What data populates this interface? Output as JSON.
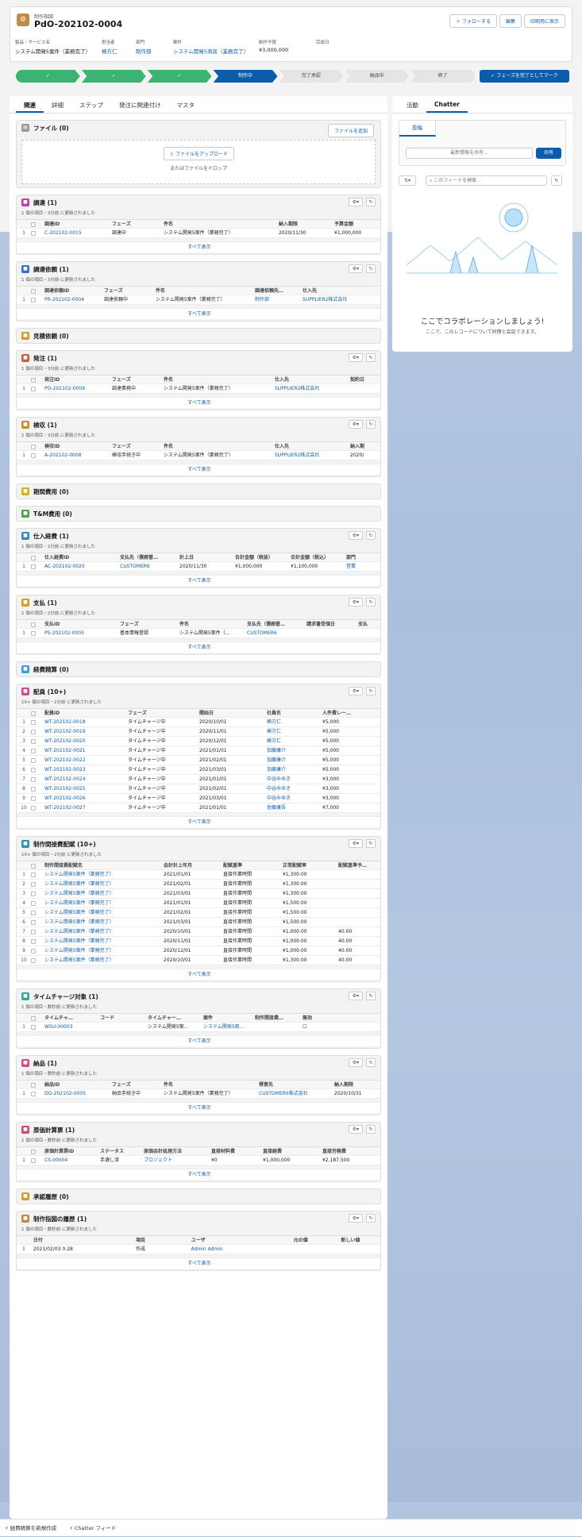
{
  "header": {
    "object_label": "制作指図",
    "title": "PdO-202102-0004",
    "buttons": [
      "フォローする",
      "編集",
      "印刷用に表示"
    ],
    "fields": [
      {
        "label": "製品・サービス名",
        "value": "システム開発5案件（業務完了）",
        "link": false
      },
      {
        "label": "担当者",
        "value": "検方仁",
        "link": true
      },
      {
        "label": "部門",
        "value": "制作部",
        "link": true
      },
      {
        "label": "案件",
        "value": "システム開発5商談（業務完了）",
        "link": true
      },
      {
        "label": "制作予算",
        "value": "¥3,000,000",
        "link": false
      },
      {
        "label": "完成日",
        "value": "",
        "link": false
      }
    ]
  },
  "path": {
    "steps": [
      "✓",
      "✓",
      "✓",
      "制作中",
      "完了承認",
      "納品中",
      "終了"
    ],
    "current_index": 3,
    "mark_button": "✓ フェーズを完了としてマーク"
  },
  "tabs": [
    "関連",
    "詳細",
    "ステップ",
    "発注に関連付け",
    "マスタ"
  ],
  "files": {
    "title": "ファイル (0)",
    "add_button": "ファイルを追加",
    "upload_button": "ファイルをアップロード",
    "drop_text": "またはファイルをドロップ"
  },
  "cards": [
    {
      "title": "調達 (1)",
      "color": "#c23ea6",
      "sub": "1 個の項目・3分前 に更新されました",
      "cols": [
        "調達ID",
        "フェーズ",
        "件名",
        "納入期限",
        "予算金額"
      ],
      "widths": [
        85,
        65,
        145,
        70,
        60
      ],
      "rows": [
        [
          "C-202102-0015",
          "調達中",
          "システム開発5案件（業務完了）",
          "2020/11/30",
          "¥1,000,000"
        ]
      ],
      "links": [
        0
      ]
    },
    {
      "title": "調達依頼 (1)",
      "color": "#3b6ec4",
      "sub": "1 個の項目・3分前 に更新されました",
      "cols": [
        "調達依頼ID",
        "フェーズ",
        "件名",
        "調達依頼先…",
        "仕入先"
      ],
      "widths": [
        75,
        65,
        125,
        60,
        85
      ],
      "rows": [
        [
          "PR-202102-0004",
          "調達依頼中",
          "システム開発5案件（業務完了）",
          "制作部",
          "SUPPLIER2株式会社"
        ]
      ],
      "links": [
        0,
        3,
        4
      ]
    },
    {
      "title": "見積依頼 (0)",
      "color": "#c9a227",
      "empty": true
    },
    {
      "title": "発注 (1)",
      "color": "#d65a3a",
      "sub": "1 個の項目・3分前 に更新されました",
      "cols": [
        "発注ID",
        "フェーズ",
        "件名",
        "仕入先",
        "契約日"
      ],
      "widths": [
        85,
        65,
        140,
        95,
        40
      ],
      "rows": [
        [
          "PO-202102-0009",
          "調達業務中",
          "システム開発5案件（業務完了）",
          "SUPPLIER2株式会社",
          ""
        ]
      ],
      "links": [
        0,
        3
      ]
    },
    {
      "title": "検収 (1)",
      "color": "#d08a2a",
      "sub": "1 個の項目・3分前 に更新されました",
      "cols": [
        "検収ID",
        "フェーズ",
        "件名",
        "仕入先",
        "納入期"
      ],
      "widths": [
        85,
        65,
        140,
        95,
        40
      ],
      "rows": [
        [
          "A-202102-0008",
          "検収手続き中",
          "システム開発5案件（業務完了）",
          "SUPPLIER2株式会社",
          "2020/"
        ]
      ],
      "links": [
        0,
        3
      ]
    },
    {
      "title": "期間費用 (0)",
      "color": "#d4b21e",
      "empty": true
    },
    {
      "title": "T&M費用 (0)",
      "color": "#4aa54a",
      "empty": true
    },
    {
      "title": "仕入経費 (1)",
      "color": "#2f8fb5",
      "sub": "1 個の項目・2分前 に更新されました",
      "cols": [
        "仕入経費ID",
        "支払先（債務管…",
        "計上日",
        "合計金額（税抜）",
        "合計金額（税込）",
        "部門"
      ],
      "widths": [
        95,
        75,
        70,
        70,
        70,
        45
      ],
      "rows": [
        [
          "AC-202102-0020",
          "CUSTOMER6",
          "2020/11/30",
          "¥1,000,000",
          "¥1,100,000",
          "営業"
        ]
      ],
      "links": [
        0,
        1,
        5
      ]
    },
    {
      "title": "支払 (1)",
      "color": "#c9a227",
      "sub": "1 個の項目・2分前 に更新されました",
      "cols": [
        "支払ID",
        "フェーズ",
        "件名",
        "支払先（債務管…",
        "請求書受領日",
        "支払"
      ],
      "widths": [
        95,
        75,
        85,
        75,
        65,
        30
      ],
      "rows": [
        [
          "PS-202102-0005",
          "基本情報登録",
          "システム開発5案件（…",
          "CUSTOMER6",
          "",
          ""
        ]
      ],
      "links": [
        0,
        3
      ]
    },
    {
      "title": "経費精算 (0)",
      "color": "#3a9fd0",
      "empty": true
    },
    {
      "title": "配員 (10+)",
      "color": "#d64a88",
      "sub": "10+ 個の項目・2分前 に更新されました",
      "cols": [
        "配員ID",
        "フェーズ",
        "開始日",
        "社員名",
        "人件費レー…"
      ],
      "widths": [
        105,
        90,
        85,
        70,
        50
      ],
      "rows": [
        [
          "WT-202102-0018",
          "タイムチャージ中",
          "2020/10/01",
          "検方仁",
          "¥5,000"
        ],
        [
          "WT-202102-0019",
          "タイムチャージ中",
          "2020/11/01",
          "検方仁",
          "¥5,000"
        ],
        [
          "WT-202102-0020",
          "タイムチャージ中",
          "2020/12/01",
          "検方仁",
          "¥5,000"
        ],
        [
          "WT-202102-0021",
          "タイムチャージ中",
          "2021/01/01",
          "加藤康介",
          "¥5,000"
        ],
        [
          "WT-202102-0022",
          "タイムチャージ中",
          "2021/02/01",
          "加藤康介",
          "¥5,000"
        ],
        [
          "WT-202102-0023",
          "タイムチャージ中",
          "2021/03/01",
          "加藤康介",
          "¥5,000"
        ],
        [
          "WT-202102-0024",
          "タイムチャージ中",
          "2021/01/01",
          "中谷みゆき",
          "¥3,000"
        ],
        [
          "WT-202102-0025",
          "タイムチャージ中",
          "2021/02/01",
          "中谷みゆき",
          "¥3,000"
        ],
        [
          "WT-202102-0026",
          "タイムチャージ中",
          "2021/03/01",
          "中谷みゆき",
          "¥3,000"
        ],
        [
          "WT-202102-0027",
          "タイムチャージ中",
          "2021/01/01",
          "佐藤康吾",
          "¥7,000"
        ]
      ],
      "links": [
        0,
        3
      ]
    },
    {
      "title": "制作間接費配賦 (10+)",
      "color": "#2f8fb5",
      "sub": "10+ 個の項目・2分前 に更新されました",
      "cols": [
        "制作間接費配賦名",
        "会計計上年月",
        "配賦基準",
        "正常配賦率",
        "配賦基準予…"
      ],
      "widths": [
        150,
        75,
        75,
        70,
        45
      ],
      "rows": [
        [
          "システム開発5案件（業務完了）",
          "2021/01/01",
          "直接作業時間",
          "¥1,300.00",
          ""
        ],
        [
          "システム開発5案件（業務完了）",
          "2021/02/01",
          "直接作業時間",
          "¥1,300.00",
          ""
        ],
        [
          "システム開発5案件（業務完了）",
          "2021/03/01",
          "直接作業時間",
          "¥1,300.00",
          ""
        ],
        [
          "システム開発5案件（業務完了）",
          "2021/01/01",
          "直接作業時間",
          "¥1,500.00",
          ""
        ],
        [
          "システム開発5案件（業務完了）",
          "2021/02/01",
          "直接作業時間",
          "¥1,500.00",
          ""
        ],
        [
          "システム開発5案件（業務完了）",
          "2021/03/01",
          "直接作業時間",
          "¥1,500.00",
          ""
        ],
        [
          "システム開発5案件（業務完了）",
          "2020/10/01",
          "直接作業時間",
          "¥1,000.00",
          "40.00"
        ],
        [
          "システム開発5案件（業務完了）",
          "2020/11/01",
          "直接作業時間",
          "¥1,000.00",
          "40.00"
        ],
        [
          "システム開発5案件（業務完了）",
          "2020/12/01",
          "直接作業時間",
          "¥1,000.00",
          "40.00"
        ],
        [
          "システム開発5案件（業務完了）",
          "2020/10/01",
          "直接作業時間",
          "¥1,300.00",
          "40.00"
        ]
      ],
      "links": [
        0
      ]
    },
    {
      "title": "タイムチャージ対象 (1)",
      "color": "#2fa89a",
      "sub": "1 個の項目・数秒前 に更新されました",
      "cols": [
        "タイムチャ…",
        "コード",
        "タイムチャー…",
        "案件",
        "制作間接費…",
        "無効"
      ],
      "widths": [
        70,
        60,
        70,
        65,
        60,
        70
      ],
      "rows": [
        [
          "WSU-00003",
          "",
          "システム開発5案…",
          "システム開発5商…",
          "",
          "☐"
        ]
      ],
      "links": [
        0,
        3
      ]
    },
    {
      "title": "納品 (1)",
      "color": "#d64a88",
      "sub": "1 個の項目・数秒前 に更新されました",
      "cols": [
        "納品ID",
        "フェーズ",
        "件名",
        "得意先",
        "納入期限"
      ],
      "widths": [
        85,
        65,
        120,
        95,
        60
      ],
      "rows": [
        [
          "DO-202102-0005",
          "納品手続き中",
          "システム開発5案件（業務完了）",
          "CUSTOMER6株式会社",
          "2020/10/31"
        ]
      ],
      "links": [
        0,
        3
      ]
    },
    {
      "title": "原価計算票 (1)",
      "color": "#d04a6a",
      "sub": "1 個の項目・数秒前 に更新されました",
      "cols": [
        "原価計算票ID",
        "ステータス",
        "原価会計処理方法",
        "直接材料費",
        "直接経費",
        "直接労務費"
      ],
      "widths": [
        70,
        55,
        85,
        65,
        75,
        60
      ],
      "rows": [
        [
          "CS-00004",
          "手漉し済",
          "プロジェクト",
          "¥0",
          "¥1,000,000",
          "¥2,187,500"
        ]
      ],
      "links": [
        0,
        2
      ]
    },
    {
      "title": "承認履歴 (0)",
      "color": "#c9a227",
      "empty": true
    },
    {
      "title": "制作指図の履歴 (1)",
      "color": "#c28a4a",
      "sub": "1 個の項目・数秒前 に更新されました",
      "nocheck": true,
      "cols": [
        "日付",
        "項目",
        "ユーザ",
        "元の値",
        "新しい値"
      ],
      "widths": [
        130,
        70,
        130,
        60,
        55
      ],
      "rows": [
        [
          "2021/02/03 0:28",
          "作成",
          "Admin Admin",
          "",
          ""
        ]
      ],
      "links": [
        2
      ]
    }
  ],
  "all_label": "すべて表示",
  "chatter": {
    "tabs": [
      "活動",
      "Chatter"
    ],
    "post_tab": "投稿",
    "share_placeholder": "最新情報を共有...",
    "share_button": "共有",
    "search_placeholder": "このフィードを検索...",
    "headline": "ここでコラボレーションしましょう!",
    "subtext": "ここで、このレコードについて同僚と会話できます。"
  },
  "footer": {
    "items": [
      "経費精算を新規作成",
      "Chatter フィード"
    ]
  }
}
